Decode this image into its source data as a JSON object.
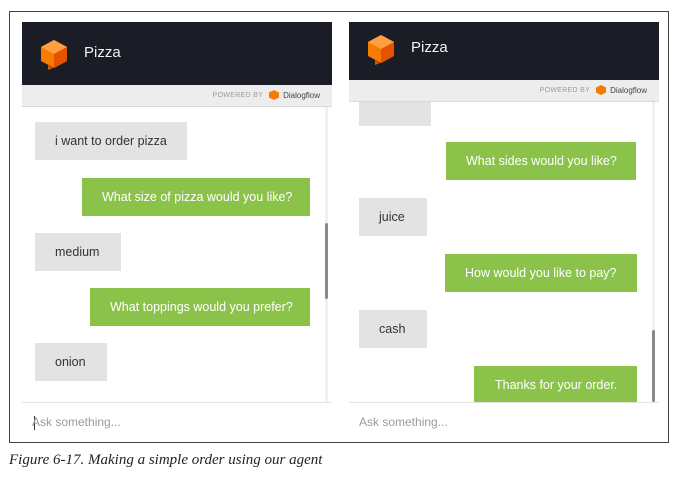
{
  "panels": [
    {
      "title": "Pizza",
      "powered_by": "POWERED BY",
      "brand": "Dialogflow",
      "messages": [
        {
          "from": "user",
          "text": "i want to order pizza"
        },
        {
          "from": "agent",
          "text": "What size of pizza would you like?"
        },
        {
          "from": "user",
          "text": "medium"
        },
        {
          "from": "agent",
          "text": "What toppings would you prefer?"
        },
        {
          "from": "user",
          "text": "onion"
        }
      ],
      "input_placeholder": "Ask something..."
    },
    {
      "title": "Pizza",
      "powered_by": "POWERED BY",
      "brand": "Dialogflow",
      "messages": [
        {
          "from": "agent",
          "text": "What sides would you like?"
        },
        {
          "from": "user",
          "text": "juice"
        },
        {
          "from": "agent",
          "text": "How would you like to pay?"
        },
        {
          "from": "user",
          "text": "cash"
        },
        {
          "from": "agent",
          "text": "Thanks for your order."
        }
      ],
      "input_placeholder": "Ask something..."
    }
  ],
  "caption": "Figure 6-17. Making a simple order using our agent",
  "colors": {
    "header_bg": "#1a1d26",
    "agent_bubble": "#8bc34a",
    "user_bubble": "#e3e3e3",
    "logo_orange": "#f57c00"
  }
}
